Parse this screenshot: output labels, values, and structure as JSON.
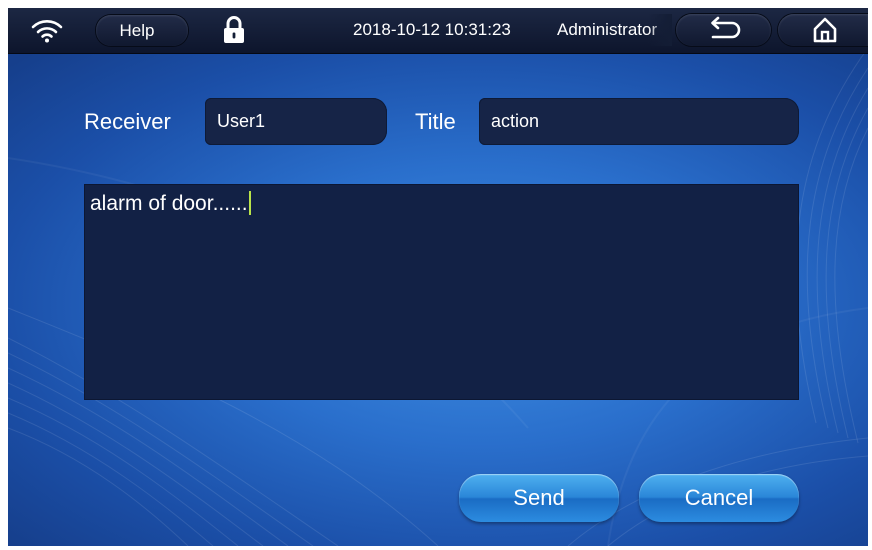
{
  "topbar": {
    "wifi_icon": "wifi-icon",
    "help_label": "Help",
    "lock_icon": "lock-icon",
    "datetime": "2018-10-12 10:31:23",
    "user": "Administrator",
    "back_icon": "back-arrow-icon",
    "home_icon": "home-icon"
  },
  "form": {
    "receiver_label": "Receiver",
    "receiver_value": "User1",
    "title_label": "Title",
    "title_value": "action",
    "message_value": "alarm of door......"
  },
  "buttons": {
    "send_label": "Send",
    "cancel_label": "Cancel"
  },
  "colors": {
    "background": "#2a6fcc",
    "topbar": "#131d35",
    "field": "#162447",
    "button": "#2a86d8",
    "caret": "#b9e34a"
  }
}
